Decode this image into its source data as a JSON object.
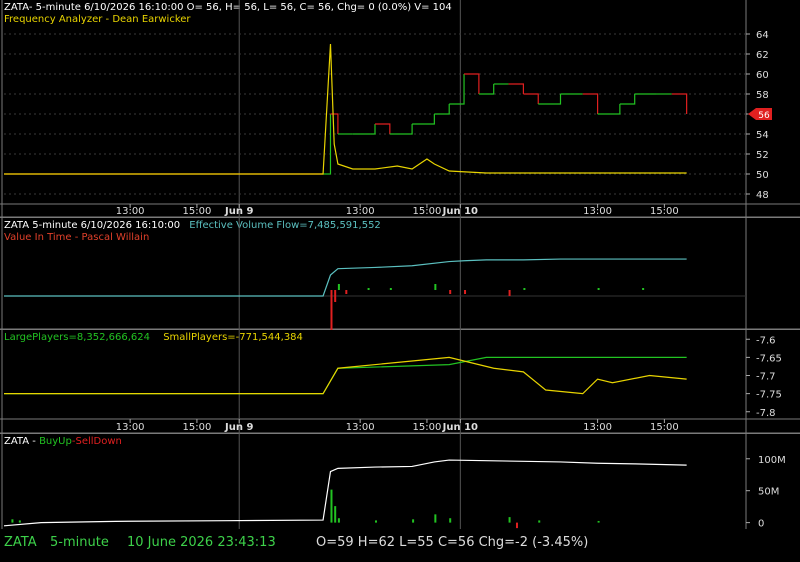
{
  "symbol": "ZATA",
  "panels": {
    "p1": {
      "header": "ZATA- 5-minute 6/10/2026 16:10:00 O= 56, H= 56, L= 56, C= 56, Chg= 0 (0.0%) V= 104",
      "study": "Frequency Analyzer - Dean Earwicker",
      "price_tag": "56"
    },
    "p2": {
      "header_a": "ZATA 5-minute  6/10/2026 16:10:00",
      "header_b": "Effective Volume Flow=7,485,591,552",
      "study": "Value In Time - Pascal Willain"
    },
    "p3": {
      "header_a": "LargePlayers=8,352,666,624",
      "header_b": "SmallPlayers=-771,544,384"
    },
    "p4": {
      "header_a": "ZATA - ",
      "header_b": "BuyUp",
      "header_c": "-",
      "header_d": "SellDown"
    }
  },
  "time_axis": [
    "13:00",
    "15:00",
    "Jun 9",
    "13:00",
    "15:00",
    "Jun 10",
    "13:00",
    "15:00"
  ],
  "status_bar": {
    "symbol": "ZATA",
    "interval": "5-minute",
    "datetime": "10 June 2026 23:43:13",
    "ohlc": "O=59   H=62   L=55   C=56   Chg=-2  (-3.45%)"
  },
  "colors": {
    "up": "#22c322",
    "down": "#e02020",
    "yellow": "#e8d400",
    "cyan": "#5bc0c0",
    "grid": "#3a3a3a"
  },
  "chart_data": [
    {
      "type": "line",
      "title": "Frequency Analyzer - Dean Earwicker",
      "ylim": [
        47,
        65
      ],
      "yticks": [
        48,
        50,
        52,
        54,
        56,
        58,
        60,
        62,
        64
      ],
      "series": [
        {
          "name": "price",
          "x": [
            0,
            0.43,
            0.44,
            0.45,
            0.47,
            0.5,
            0.52,
            0.55,
            0.58,
            0.6,
            0.62,
            0.64,
            0.66,
            0.68,
            0.7,
            0.72,
            0.75,
            0.78,
            0.8,
            0.83,
            0.85,
            0.88,
            0.9,
            0.92
          ],
          "y": [
            50,
            50,
            56,
            54,
            54,
            55,
            54,
            55,
            56,
            57,
            60,
            58,
            59,
            59,
            58,
            57,
            58,
            58,
            56,
            57,
            58,
            58,
            58,
            56
          ]
        },
        {
          "name": "frequency",
          "x": [
            0,
            0.43,
            0.44,
            0.445,
            0.45,
            0.47,
            0.5,
            0.53,
            0.55,
            0.57,
            0.58,
            0.6,
            0.65,
            0.92
          ],
          "y": [
            50,
            50,
            63,
            53,
            51,
            50.5,
            50.5,
            50.8,
            50.5,
            51.5,
            51,
            50.3,
            50.1,
            50.1
          ]
        }
      ]
    },
    {
      "type": "line",
      "title": "Value In Time - Pascal Willain",
      "series": [
        {
          "name": "Effective Volume Flow",
          "x": [
            0,
            0.43,
            0.44,
            0.45,
            0.5,
            0.55,
            0.6,
            0.62,
            0.65,
            0.7,
            0.75,
            0.8,
            0.92
          ],
          "y": [
            0.0,
            0.0,
            0.5,
            0.65,
            0.68,
            0.72,
            0.82,
            0.84,
            0.86,
            0.86,
            0.88,
            0.88,
            0.88
          ]
        }
      ]
    },
    {
      "type": "line",
      "ylim": [
        -7.82,
        -7.58
      ],
      "yticks": [
        -7.6,
        -7.65,
        -7.7,
        -7.75,
        -7.8
      ],
      "series": [
        {
          "name": "LargePlayers",
          "x": [
            0,
            0.43,
            0.45,
            0.6,
            0.65,
            0.92
          ],
          "y": [
            -7.75,
            -7.75,
            -7.68,
            -7.67,
            -7.65,
            -7.65
          ]
        },
        {
          "name": "SmallPlayers",
          "x": [
            0,
            0.43,
            0.45,
            0.55,
            0.6,
            0.62,
            0.66,
            0.7,
            0.73,
            0.78,
            0.8,
            0.82,
            0.87,
            0.92
          ],
          "y": [
            -7.75,
            -7.75,
            -7.68,
            -7.66,
            -7.65,
            -7.66,
            -7.68,
            -7.69,
            -7.74,
            -7.75,
            -7.71,
            -7.72,
            -7.7,
            -7.71
          ]
        }
      ]
    },
    {
      "type": "line",
      "ylim": [
        -10,
        120
      ],
      "yticks": [
        0,
        50,
        100
      ],
      "ytick_labels": [
        "0",
        "50M",
        "100M"
      ],
      "series": [
        {
          "name": "BuyUp-SellDown",
          "x": [
            0,
            0.05,
            0.15,
            0.3,
            0.43,
            0.44,
            0.45,
            0.5,
            0.55,
            0.58,
            0.6,
            0.65,
            0.7,
            0.75,
            0.8,
            0.85,
            0.92
          ],
          "y": [
            -5,
            0,
            2,
            3,
            4,
            80,
            85,
            87,
            88,
            95,
            98,
            97,
            96,
            95,
            93,
            92,
            90
          ]
        }
      ]
    }
  ]
}
